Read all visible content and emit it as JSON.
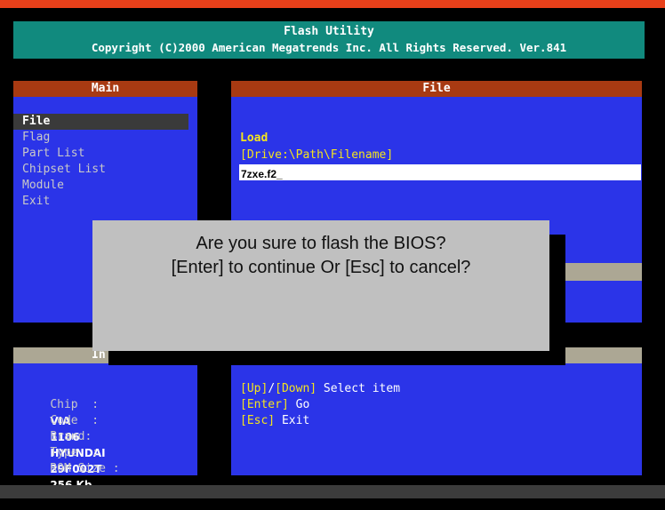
{
  "header": {
    "top_strip_color": "#e8401a",
    "title": "Flash Utility",
    "copyright": "Copyright (C)2000 American Megatrends Inc. All Rights Reserved. Ver.841"
  },
  "main_panel": {
    "title": "Main",
    "items": [
      {
        "label": "File",
        "selected": true
      },
      {
        "label": "Flag",
        "selected": false
      },
      {
        "label": "Part List",
        "selected": false
      },
      {
        "label": "Chipset List",
        "selected": false
      },
      {
        "label": "Module",
        "selected": false
      },
      {
        "label": "Exit",
        "selected": false
      }
    ]
  },
  "file_panel": {
    "title": "File",
    "load_label": "Load",
    "path_hint": "[Drive:\\Path\\Filename]",
    "filename_value": "7zxe.f2_"
  },
  "info_panel": {
    "title_visible": "In",
    "chip_label": "Chip  :",
    "chip_value": "VIA",
    "code_label": "Code  :",
    "code_value": "1106",
    "brand_label": "Brand:",
    "brand_value": "HYUNDAI",
    "type_label": "Type  :",
    "type_value": "29F002T",
    "rom_label": "ROM Size :",
    "rom_value": "256 Kb"
  },
  "help_panel": {
    "up_key": "[Up]",
    "slash": "/",
    "down_key": "[Down]",
    "select_text": " Select item",
    "enter_key": "[Enter]",
    "go_text": " Go",
    "esc_key": "[Esc]",
    "exit_text": " Exit"
  },
  "dialog": {
    "line1": "Are you sure to flash the BIOS?",
    "line2": "[Enter] to continue Or [Esc] to cancel?"
  }
}
